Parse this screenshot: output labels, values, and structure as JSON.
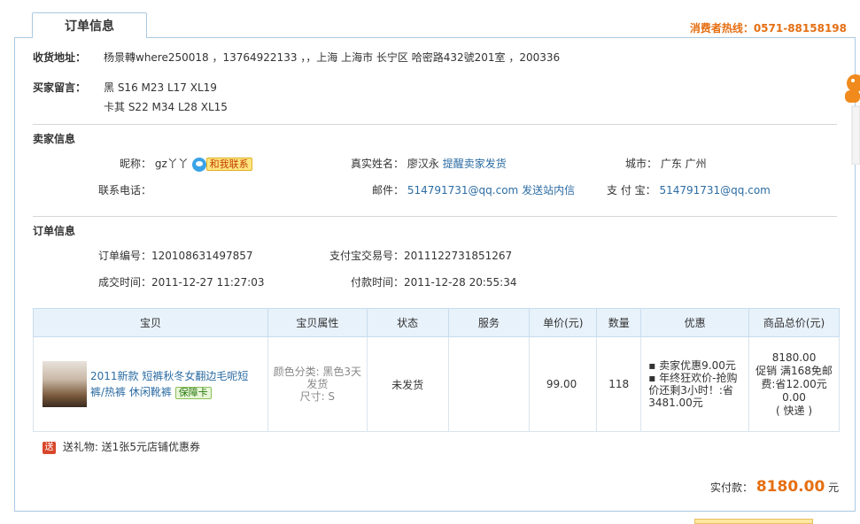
{
  "tab": {
    "title": "订单信息"
  },
  "hotline": "消费者热线：0571-88158198",
  "address": {
    "label": "收货地址：",
    "value": "杨景轉where250018 ，13764922133 ，，上海 上海市 长宁区 哈密路432號201室 ，200336"
  },
  "buyer_note": {
    "label": "买家留言：",
    "line1": "黑 S16 M23 L17 XL19",
    "line2": "卡其 S22 M34 L28 XL15"
  },
  "seller": {
    "title": "卖家信息",
    "nickname_label": "昵称：",
    "nickname": "gz丫丫",
    "contact_button": "和我联系",
    "realname_label": "真实姓名：",
    "realname": "廖汉永",
    "remind_link": "提醒卖家发货",
    "city_label": "城市：",
    "city": "广东 广州",
    "phone_label": "联系电话：",
    "email_label": "邮件：",
    "email": "514791731@qq.com",
    "message_link": "发送站内信",
    "alipay_label": "支 付 宝：",
    "alipay": "514791731@qq.com"
  },
  "order": {
    "title": "订单信息",
    "no_label": "订单编号：",
    "no": "120108631497857",
    "trade_label": "支付宝交易号：",
    "trade": "2011122731851267",
    "deal_label": "成交时间：",
    "deal_time": "2011-12-27 11:27:03",
    "pay_label": "付款时间：",
    "pay_time": "2011-12-28 20:55:34"
  },
  "table": {
    "headers": [
      "宝贝",
      "宝贝属性",
      "状态",
      "服务",
      "单价(元)",
      "数量",
      "优惠",
      "商品总价(元)"
    ],
    "item": {
      "title": "2011新款 短裤秋冬女翻边毛呢短裤/热裤 休闲靴裤",
      "guarantee": "保障卡",
      "prop1": "颜色分类: 黑色3天发货",
      "prop2": "尺寸: S",
      "status": "未发货",
      "service": "",
      "price": "99.00",
      "qty": "118",
      "promo1": "卖家优惠9.00元",
      "promo2": "年终狂欢价-抢购价还剩3小时！:省3481.00元",
      "total": "8180.00",
      "promo_total": "促销 满168免邮费:省12.00元",
      "shipping": "0.00",
      "shipping_type": "( 快递 )"
    }
  },
  "gift": {
    "icon": "送",
    "text": "送礼物: 送1张5元店铺优惠券"
  },
  "paid": {
    "label": "实付款：",
    "amount": "8180.00",
    "unit": "元"
  }
}
